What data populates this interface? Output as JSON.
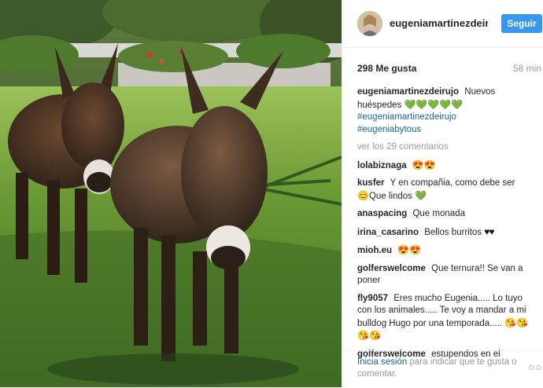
{
  "post": {
    "username": "eugeniamartinezdeir...",
    "follow_label": "Seguir",
    "likes": "298 Me gusta",
    "time": "58 min"
  },
  "caption": {
    "user": "eugeniamartinezdeirujo",
    "text": "Nuevos huéspedes",
    "hashtag1": "#eugeniamartinezdeirujo",
    "hashtag2": "#eugeniabytous"
  },
  "view_comments": "ver los 29 comentarios",
  "comments": [
    {
      "user": "lolabiznaga",
      "text": ""
    },
    {
      "user": "kusfer",
      "text": "Y en compañia, como debe ser",
      "text2": "Que lindos"
    },
    {
      "user": "anaspacing",
      "text": "Que monada"
    },
    {
      "user": "irina_casarino",
      "text": "Bellos burritos"
    },
    {
      "user": "mioh.eu",
      "text": ""
    },
    {
      "user": "golferswelcome",
      "text": "Que ternura!! Se van a poner"
    },
    {
      "user": "fly9057",
      "text": "Eres mucho Eugenia..... Lo tuyo con los animales..... Te voy a mandar a mi bulldog Hugo por una temporada....."
    },
    {
      "user": "golferswelcome",
      "text": "estupendos en el campo"
    }
  ],
  "footer": {
    "login_link": "Inicia sesión",
    "login_text": "para indicar que te gusta o comentar.",
    "more_icon": "ellipsis-icon"
  },
  "colors": {
    "accent": "#3897f0",
    "link": "#1c5f9c",
    "muted": "#999999",
    "grass": "#4f8a2c"
  }
}
